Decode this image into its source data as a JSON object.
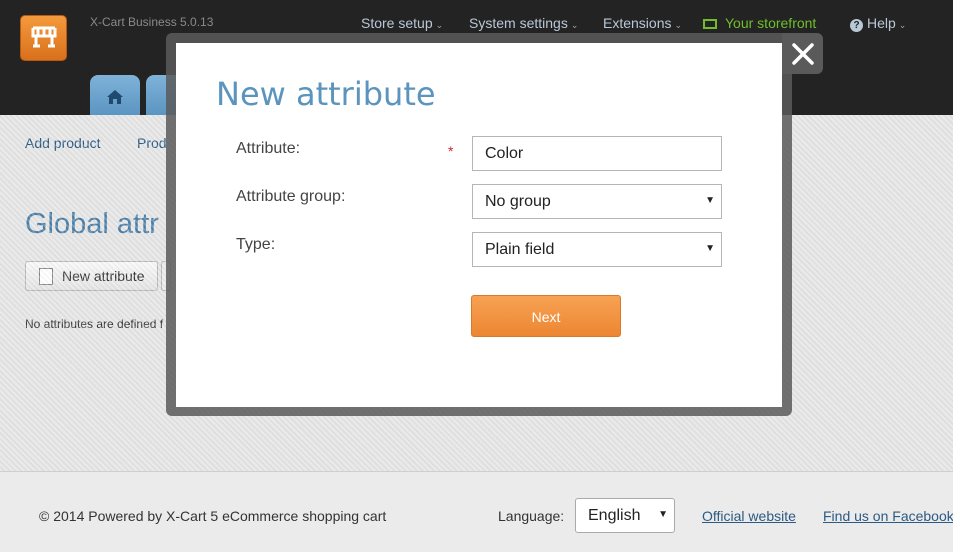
{
  "header": {
    "version": "X-Cart Business 5.0.13",
    "nav": [
      {
        "label": "Store setup"
      },
      {
        "label": "System settings"
      },
      {
        "label": "Extensions"
      },
      {
        "label": "Your storefront"
      },
      {
        "label": "Help"
      }
    ]
  },
  "subnav": {
    "add_product": "Add product",
    "products": "Prod"
  },
  "page": {
    "title": "Global attr",
    "new_attribute_button": "New attribute",
    "empty_message": "No attributes are defined f"
  },
  "modal": {
    "title": "New attribute",
    "required_mark": "*",
    "fields": {
      "attribute_label": "Attribute:",
      "attribute_value": "Color",
      "group_label": "Attribute group:",
      "group_value": "No group",
      "type_label": "Type:",
      "type_value": "Plain field"
    },
    "next_button": "Next"
  },
  "footer": {
    "copyright": "© 2014 Powered by X-Cart 5 eCommerce shopping cart",
    "language_label": "Language:",
    "language_value": "English",
    "official_website": "Official website",
    "facebook": "Find us on Facebook"
  },
  "colors": {
    "accent_blue": "#5b94bd",
    "accent_orange": "#ec8632",
    "storefront_green": "#6fbf2a"
  }
}
